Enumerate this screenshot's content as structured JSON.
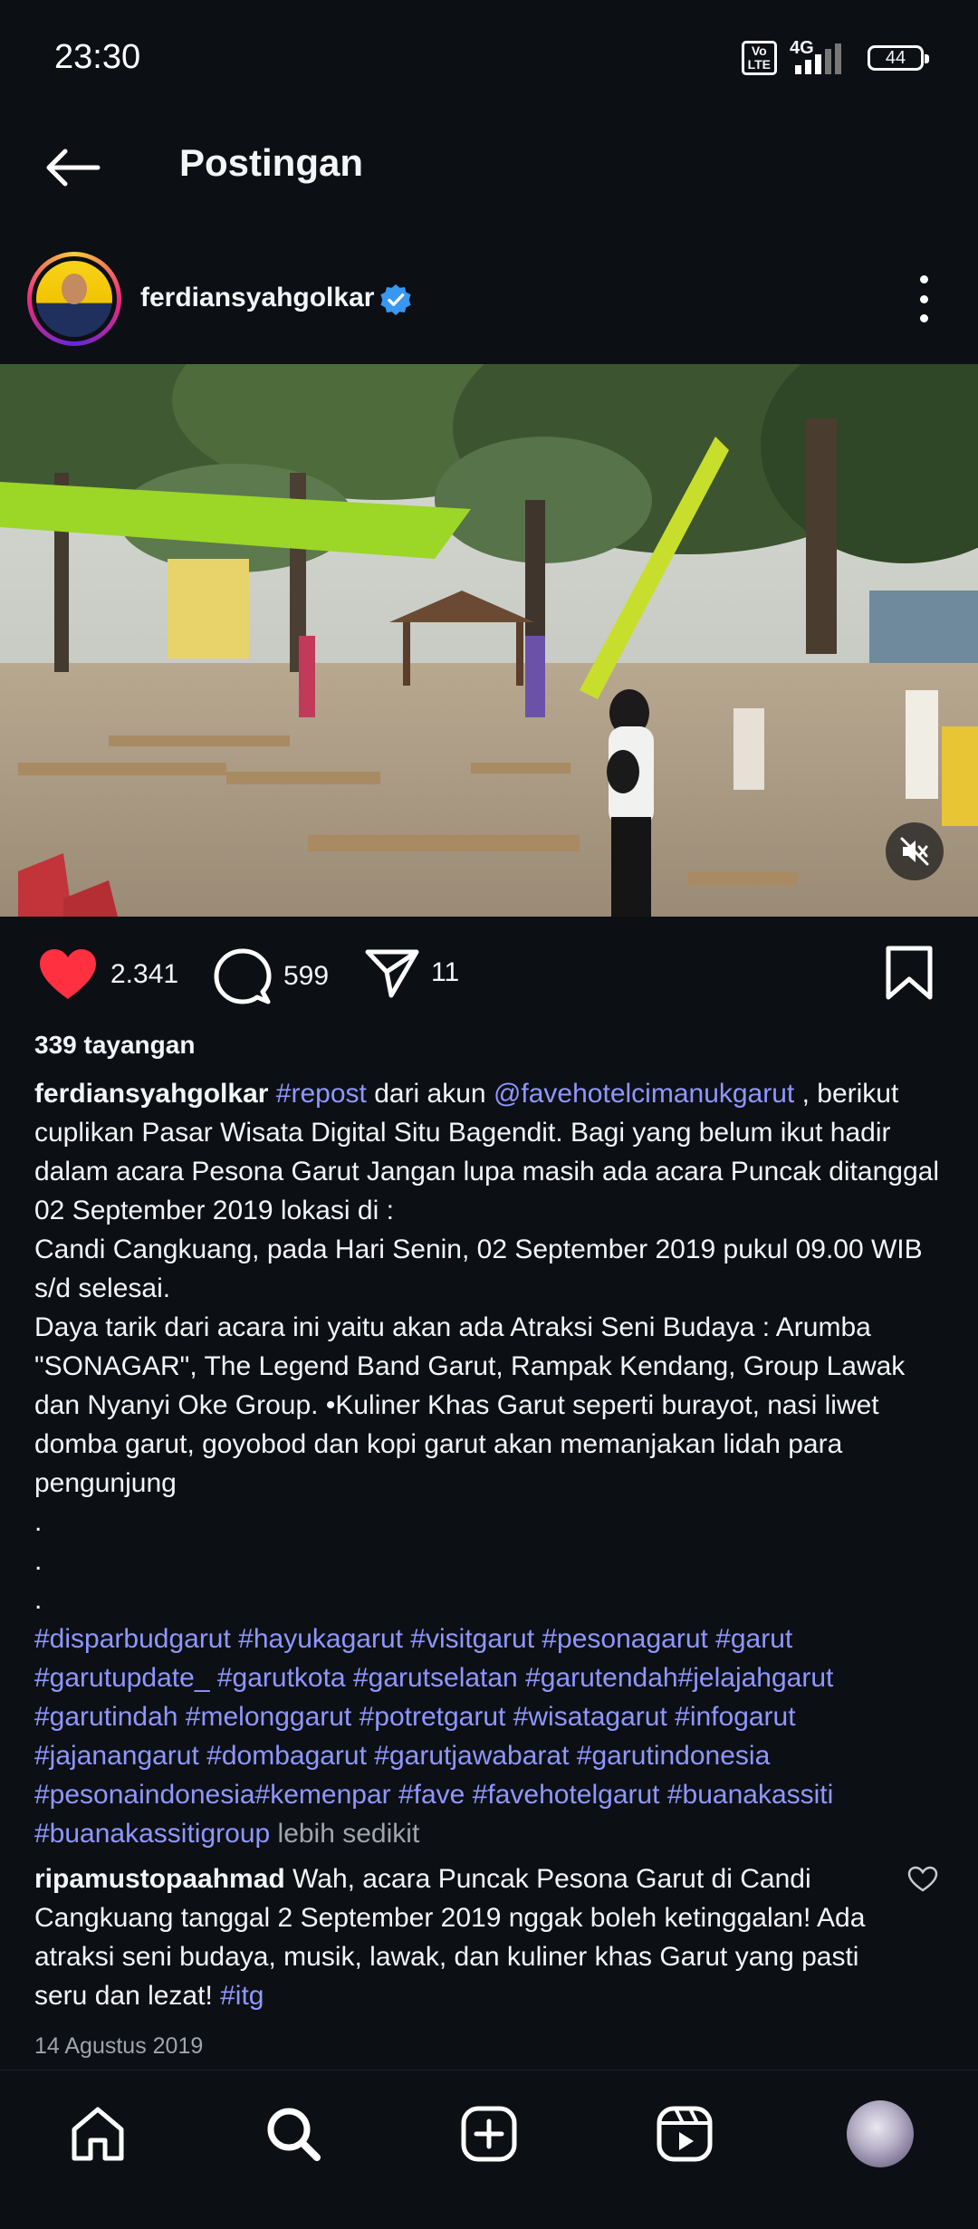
{
  "status_bar": {
    "time": "23:30",
    "volte_line1": "Vo",
    "volte_line2": "LTE",
    "network": "4G",
    "battery": "44"
  },
  "header": {
    "title": "Postingan"
  },
  "post": {
    "username": "ferdiansyahgolkar",
    "likes": "2.341",
    "comments": "599",
    "shares": "11",
    "views": "339 tayangan",
    "caption": {
      "username": "ferdiansyahgolkar",
      "repost_tag": "#repost",
      "text1": " dari akun ",
      "mention": "@favehotelcimanukgarut",
      "text2": " , berikut cuplikan Pasar Wisata Digital Situ Bagendit. Bagi yang belum ikut hadir dalam acara Pesona Garut Jangan lupa masih ada acara Puncak ditanggal 02 September 2019 lokasi di :",
      "line_location": "Candi Cangkuang, pada Hari Senin, 02 September 2019 pukul 09.00 WIB s/d selesai.",
      "line_attraction": "Daya tarik dari acara ini yaitu akan ada Atraksi Seni Budaya : Arumba \"SONAGAR\", The Legend Band Garut, Rampak Kendang, Group Lawak dan Nyanyi Oke Group. •Kuliner Khas Garut seperti burayot, nasi liwet domba garut, goyobod dan kopi garut akan memanjakan lidah para pengunjung",
      "dot1": ".",
      "dot2": ".",
      "dot3": ".",
      "hashtags": "#disparbudgarut #hayukagarut #visitgarut #pesonagarut #garut #garutupdate_ #garutkota #garutselatan #garutendah#jelajahgarut #garutindah #melonggarut #potretgarut #wisatagarut #infogarut #jajanangarut #dombagarut #garutjawabarat #garutindonesia #pesonaindonesia#kemenpar #fave #favehotelgarut #buanakassiti #buanakassitigroup",
      "less": " lebih sedikit"
    },
    "comment": {
      "username": "ripamustopaahmad",
      "text": " Wah, acara Puncak Pesona Garut di Candi Cangkuang tanggal 2 September 2019 nggak boleh ketinggalan! Ada atraksi seni budaya, musik, lawak, dan kuliner khas Garut yang pasti seru dan lezat! ",
      "tag": "#itg"
    },
    "date": "14 Agustus 2019"
  },
  "colors": {
    "background": "#0c0f14",
    "link": "#8f97ff",
    "like_red": "#ff3040",
    "verified_blue": "#3897f0"
  },
  "icons": {
    "back": "arrow-left-icon",
    "like": "heart-icon",
    "comment": "comment-bubble-icon",
    "share": "paper-plane-icon",
    "save": "bookmark-icon",
    "mute": "speaker-muted-icon",
    "nav": [
      "home-icon",
      "search-icon",
      "create-icon",
      "reels-icon",
      "profile-avatar"
    ]
  }
}
